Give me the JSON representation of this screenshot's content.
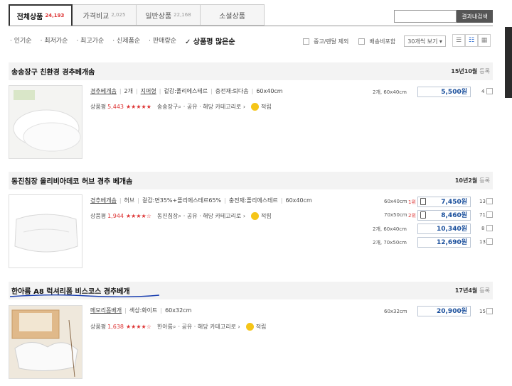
{
  "tabs": [
    {
      "label": "전체상품",
      "count": "24,193"
    },
    {
      "label": "가격비교",
      "count": "2,025"
    },
    {
      "label": "일반상품",
      "count": "22,168"
    },
    {
      "label": "소셜상품",
      "count": ""
    }
  ],
  "search": {
    "button": "결과내검색",
    "value": ""
  },
  "sort": [
    "인기순",
    "최저가순",
    "최고가순",
    "신제품순",
    "판매량순",
    "상품평 많은순"
  ],
  "options": {
    "used": "중고/렌탈 제외",
    "shipping": "배송비포함",
    "perpage": "30개씩 보기"
  },
  "products": [
    {
      "name": "송송장구 친환경 경추베개솜",
      "date": "15년10월",
      "date_suffix": "등록",
      "specs": [
        "경추베개솜",
        "2개",
        "지퍼형",
        "겉감:폴리에스테르",
        "충전재:퇴다솜",
        "60x40cm"
      ],
      "review_label": "상품평",
      "review_count": "5,443",
      "stars": "★★★★★",
      "maker": "송송장구",
      "actions": "· 공유 · 해당 카테고리로 ›",
      "point": "적립",
      "prices": [
        {
          "opt": "2개, 60x40cm",
          "price": "5,500원",
          "cnt": "4"
        }
      ]
    },
    {
      "name": "동진침장 올리비아데코 허브 경추 베개솜",
      "date": "10년2월",
      "date_suffix": "등록",
      "specs": [
        "경추베개솜",
        "허브",
        "겉감:면35%+폴리에스테르65%",
        "충전재:폴리에스테르",
        "60x40cm"
      ],
      "review_label": "상품평",
      "review_count": "1,944",
      "stars": "★★★★☆",
      "maker": "동진침장",
      "actions": "· 공유 · 해당 카테고리로 ›",
      "point": "적립",
      "prices": [
        {
          "opt": "60x40cm",
          "rank": "1위",
          "price": "7,450원",
          "cnt": "13"
        },
        {
          "opt": "70x50cm",
          "rank": "2위",
          "price": "8,460원",
          "cnt": "71"
        },
        {
          "opt": "2개, 60x40cm",
          "price": "10,340원",
          "cnt": "8"
        },
        {
          "opt": "2개, 70x50cm",
          "price": "12,690원",
          "cnt": "13"
        }
      ]
    },
    {
      "name": "한아름 A8 럭셔리폼 비스코스 경추베개",
      "date": "17년4월",
      "date_suffix": "등록",
      "specs": [
        "메모리폼베개",
        "색상:화이트",
        "60x32cm"
      ],
      "review_label": "상품평",
      "review_count": "1,638",
      "stars": "★★★★☆",
      "maker": "한아름",
      "actions": "· 공유 · 해당 카테고리로 ›",
      "point": "적립",
      "prices": [
        {
          "opt": "60x32cm",
          "price": "20,900원",
          "cnt": "15"
        }
      ]
    }
  ],
  "colors": {
    "accent": "#d33333",
    "price": "#1a4f9c",
    "underline": "#1a3fb0"
  }
}
